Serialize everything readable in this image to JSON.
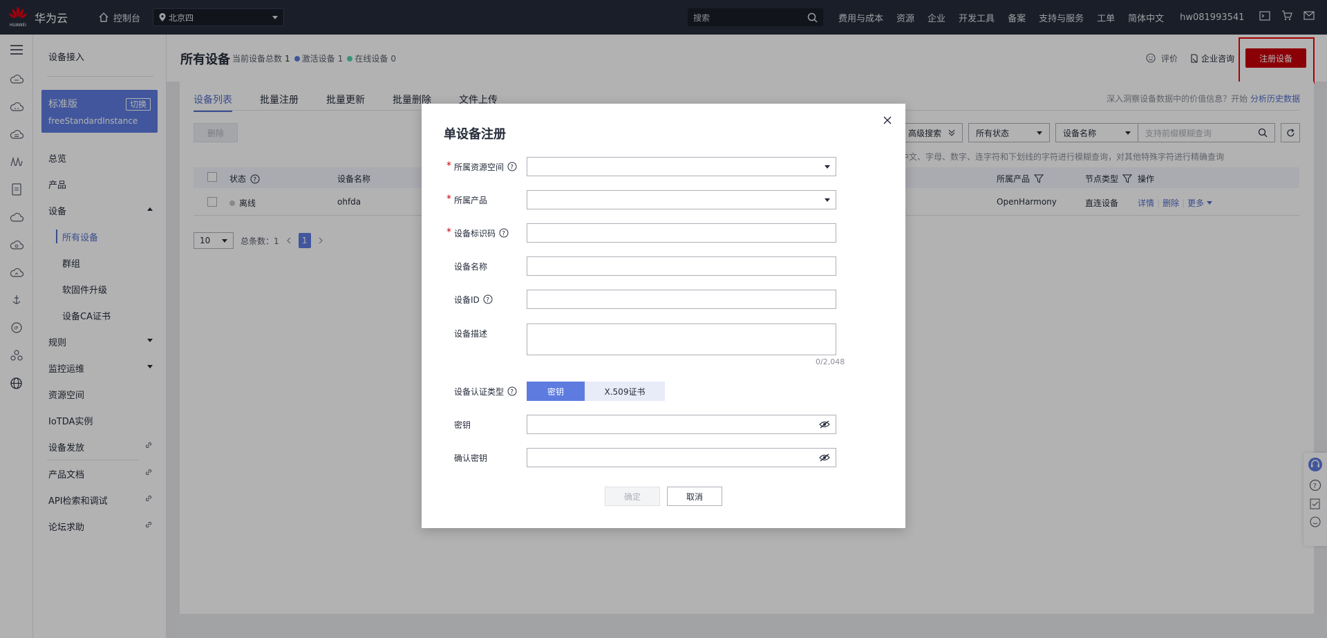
{
  "topbar": {
    "brand": "华为云",
    "brand_sub": "HUAWEI",
    "console": "控制台",
    "region": "北京四",
    "search_placeholder": "搜索",
    "nav": [
      "费用与成本",
      "资源",
      "企业",
      "开发工具",
      "备案",
      "支持与服务",
      "工单",
      "简体中文"
    ],
    "user": "hw081993541"
  },
  "sidebar": {
    "title": "设备接入",
    "edition": {
      "name": "标准版",
      "switch": "切换",
      "instance": "freeStandardInstance"
    },
    "menu": {
      "overview": "总览",
      "products": "产品",
      "devices": "设备",
      "all_devices": "所有设备",
      "groups": "群组",
      "firmware": "软固件升级",
      "ca_cert": "设备CA证书",
      "rules": "规则",
      "monitor": "监控运维",
      "resource_space": "资源空间",
      "iotda_instance": "IoTDA实例",
      "provisioning": "设备发放",
      "product_docs": "产品文档",
      "api_explorer": "API检索和调试",
      "forum": "论坛求助"
    }
  },
  "header": {
    "title": "所有设备",
    "total_label": "当前设备总数",
    "total": "1",
    "active_label": "激活设备",
    "active": "1",
    "online_label": "在线设备",
    "online": "0",
    "rate": "评价",
    "consult": "企业咨询",
    "register": "注册设备"
  },
  "tabs": [
    "设备列表",
    "批量注册",
    "批量更新",
    "批量删除",
    "文件上传"
  ],
  "insight": {
    "text": "深入洞察设备数据中的价值信息？开始",
    "link": "分析历史数据"
  },
  "toolbar": {
    "delete": "删除",
    "advanced_search": "高级搜索",
    "status_filter": "所有状态",
    "field_filter": "设备名称",
    "search_placeholder": "支持前缀模糊查询",
    "hint": "中文、字母、数字、连字符和下划线的字符进行模糊查询，对其他特殊字符进行精确查询"
  },
  "table": {
    "headers": {
      "status": "状态",
      "name": "设备名称",
      "product": "所属产品",
      "node_type": "节点类型",
      "actions": "操作"
    },
    "rows": [
      {
        "status": "离线",
        "name": "ohfda",
        "product": "OpenHarmony",
        "node_type": "直连设备",
        "a_detail": "详情",
        "a_delete": "删除",
        "a_more": "更多"
      }
    ]
  },
  "pagination": {
    "page_size": "10",
    "total_label": "总条数：",
    "total": "1",
    "current": "1"
  },
  "dialog": {
    "title": "单设备注册",
    "fields": {
      "resource_space": "所属资源空间",
      "product": "所属产品",
      "node_id": "设备标识码",
      "device_name": "设备名称",
      "device_id": "设备ID",
      "description": "设备描述",
      "desc_counter": "0/2,048",
      "auth_type": "设备认证类型",
      "auth_secret": "密钥",
      "auth_x509": "X.509证书",
      "secret": "密钥",
      "confirm_secret": "确认密钥"
    },
    "ok": "确定",
    "cancel": "取消"
  },
  "colors": {
    "topbar": "#252b3a",
    "primary": "#5e7ce0",
    "brand_red": "#c7000b",
    "active_dot": "#5e7ce0",
    "online_dot": "#50d4ab"
  }
}
